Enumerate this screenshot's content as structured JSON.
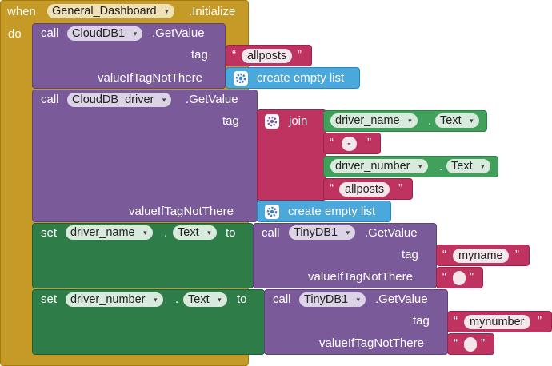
{
  "event": {
    "keyword_when": "when",
    "component": "General_Dashboard",
    "event_name": ".Initialize",
    "keyword_do": "do"
  },
  "call1": {
    "keyword": "call",
    "component": "CloudDB1",
    "method": ".GetValue",
    "tag_label": "tag",
    "tag_value": "allposts",
    "default_label": "valueIfTagNotThere",
    "default_block": "create empty list"
  },
  "call2": {
    "keyword": "call",
    "component": "CloudDB_driver",
    "method": ".GetValue",
    "tag_label": "tag",
    "join_label": "join",
    "getter1_component": "driver_name",
    "getter1_prop": "Text",
    "dot1": ".",
    "separator": "-",
    "getter2_component": "driver_number",
    "getter2_prop": "Text",
    "dot2": ".",
    "last_string": "allposts",
    "default_label": "valueIfTagNotThere",
    "default_block": "create empty list"
  },
  "set1": {
    "keyword": "set",
    "component": "driver_name",
    "dot": ".",
    "prop": "Text",
    "to": "to",
    "call_kw": "call",
    "db": "TinyDB1",
    "method": ".GetValue",
    "tag_label": "tag",
    "tag_value": "myname",
    "default_label": "valueIfTagNotThere"
  },
  "set2": {
    "keyword": "set",
    "component": "driver_number",
    "dot": ".",
    "prop": "Text",
    "to": "to",
    "call_kw": "call",
    "db": "TinyDB1",
    "method": ".GetValue",
    "tag_label": "tag",
    "tag_value": "mynumber",
    "default_label": "valueIfTagNotThere"
  },
  "glyphs": {
    "caret": "▾",
    "open_quote": "“",
    "close_quote": "”"
  },
  "colors": {
    "event": "#c69a26",
    "procedure": "#7a5a99",
    "text": "#bf3360",
    "list": "#4aa8dc",
    "setter": "#2e7d49",
    "getter": "#42a05d"
  },
  "icons": {
    "mutator": "gear-icon"
  }
}
